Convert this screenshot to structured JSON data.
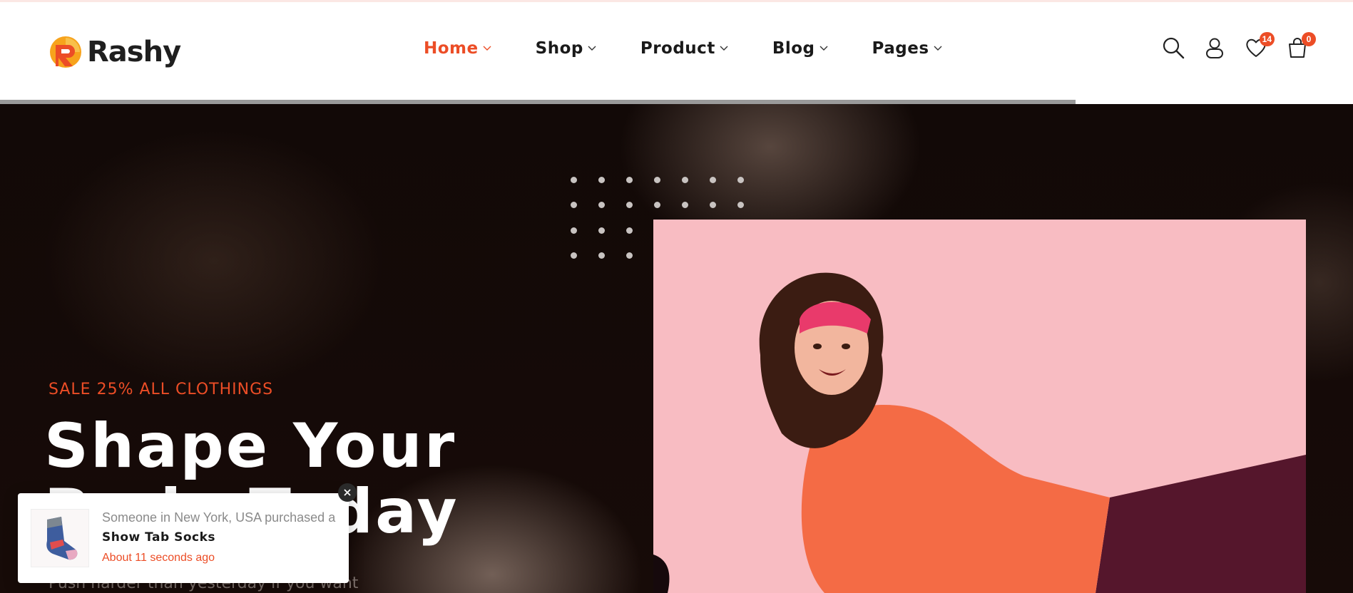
{
  "brand": {
    "name": "Rashy",
    "accent": "#ec4d26"
  },
  "nav": {
    "items": [
      {
        "label": "Home",
        "active": true
      },
      {
        "label": "Shop",
        "active": false
      },
      {
        "label": "Product",
        "active": false
      },
      {
        "label": "Blog",
        "active": false
      },
      {
        "label": "Pages",
        "active": false
      }
    ]
  },
  "header_icons": {
    "search": "search-icon",
    "account": "user-icon",
    "wishlist": {
      "icon": "heart-icon",
      "count": "14"
    },
    "cart": {
      "icon": "bag-icon",
      "count": "0"
    }
  },
  "hero": {
    "eyebrow": "SALE 25% ALL CLOTHINGS",
    "title_line1": "Shape Your",
    "title_line2": "Body Today",
    "subtitle": "Push harder than yesterday if you want",
    "image": "woman-in-orange-sweater-on-pink-background"
  },
  "toast": {
    "line1": "Someone in New York, USA purchased a",
    "product": "Show Tab Socks",
    "time": "About 11 seconds ago",
    "image": "sock-product-thumbnail"
  },
  "slider_progress": 0.795
}
